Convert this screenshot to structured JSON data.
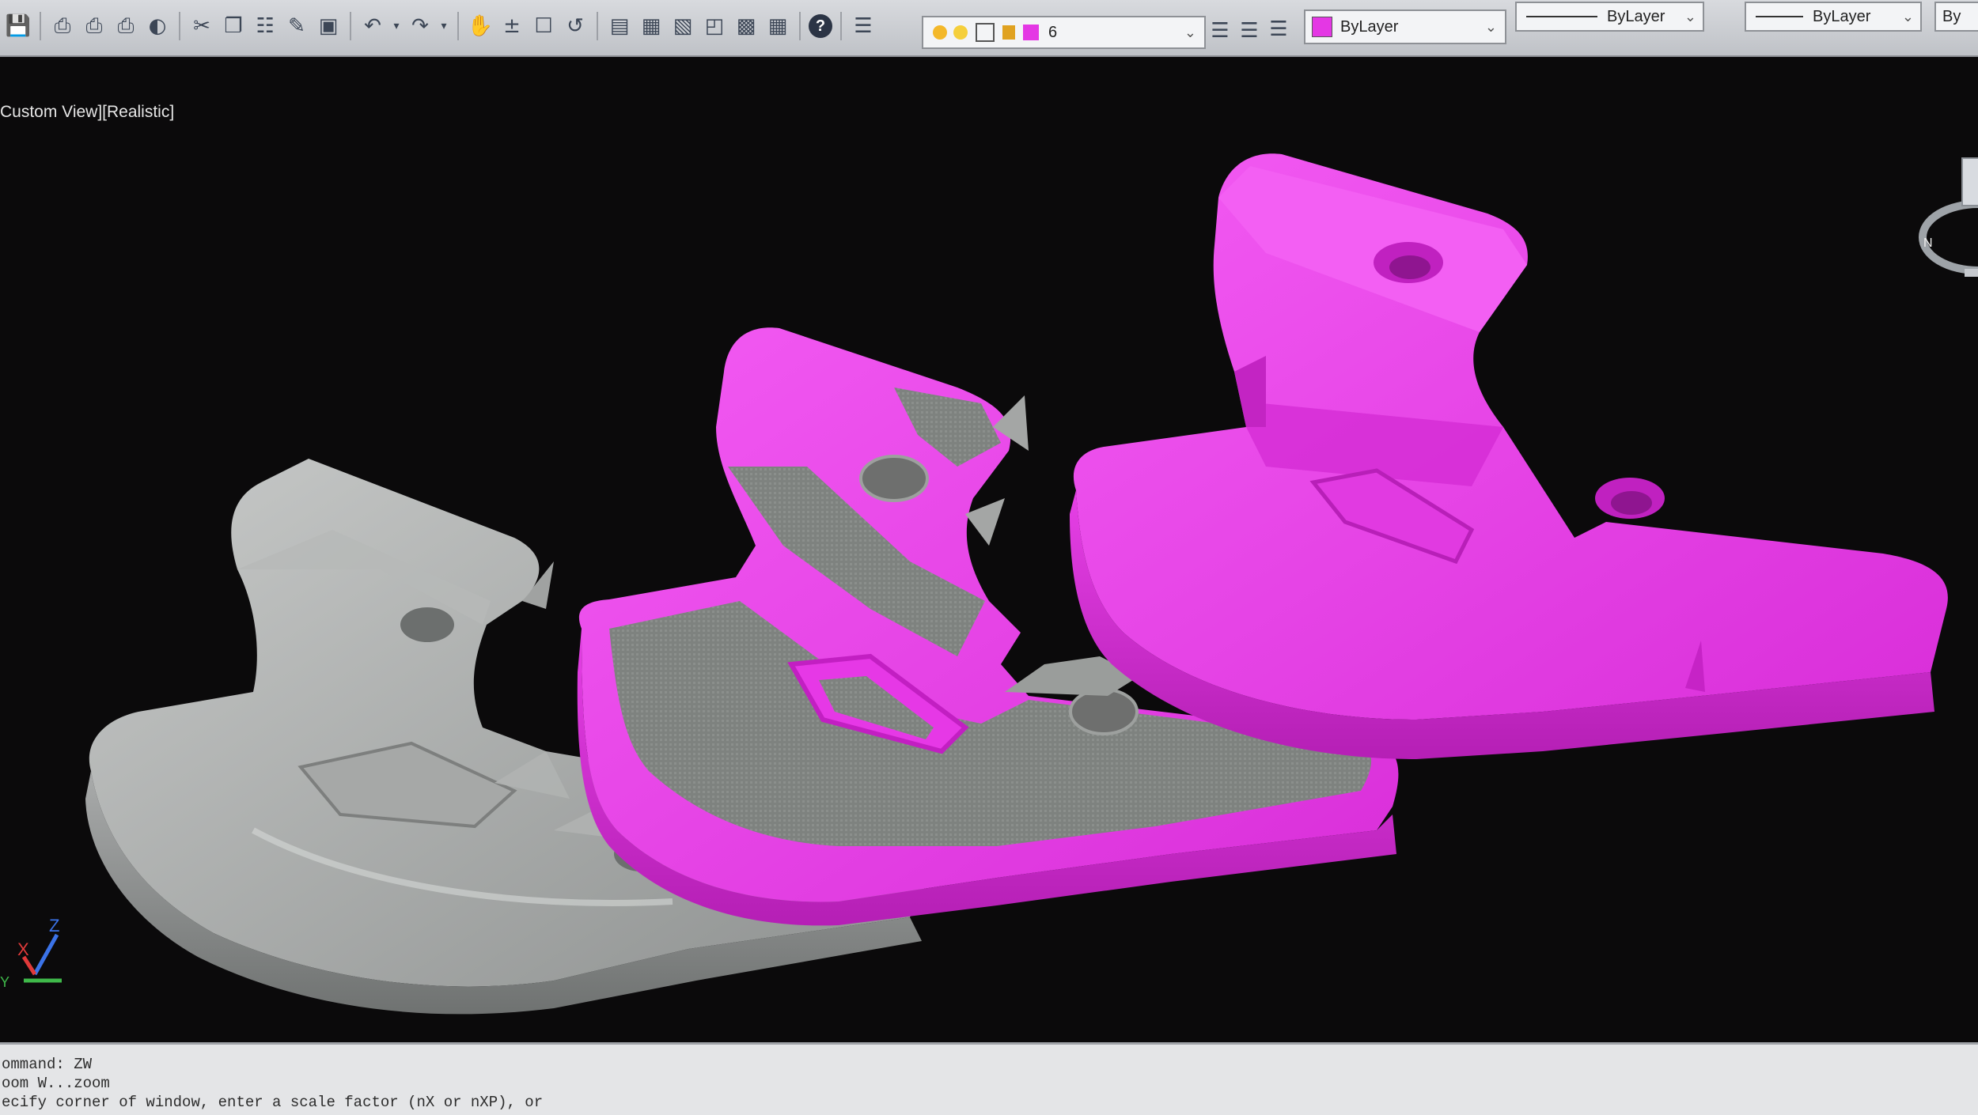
{
  "toolbar": {
    "icons": [
      "save-icon",
      "print-icon",
      "print-preview-icon",
      "plot-icon",
      "publish-icon",
      "cut-icon",
      "copy-icon",
      "paste-icon",
      "match-properties-icon",
      "block-editor-icon",
      "undo-icon",
      "redo-icon",
      "pan-icon",
      "zoom-realtime-icon",
      "zoom-window-icon",
      "zoom-previous-icon",
      "properties-icon",
      "design-center-icon",
      "tool-palettes-icon",
      "sheet-set-icon",
      "markup-icon",
      "calculator-icon",
      "help-icon",
      "layer-properties-icon"
    ],
    "layer_value": "6",
    "color_value": "ByLayer",
    "linetype_value": "ByLayer",
    "lineweight_value": "ByLayer",
    "plotstyle_value": "By"
  },
  "viewport": {
    "label": "Custom View][Realistic]",
    "objects": [
      "raw-scan-mesh",
      "overlay-mesh",
      "cad-model"
    ],
    "colors": {
      "model": "#e236e2",
      "scan": "#9ea0a2",
      "background": "#0b0a0b"
    }
  },
  "ucs": {
    "x": "X",
    "y": "Y",
    "z": "Z"
  },
  "command_line": {
    "line1": "ommand: ZW",
    "line2": "oom W...zoom",
    "line3": "ecify corner of window, enter a scale factor (nX or nXP), or"
  }
}
